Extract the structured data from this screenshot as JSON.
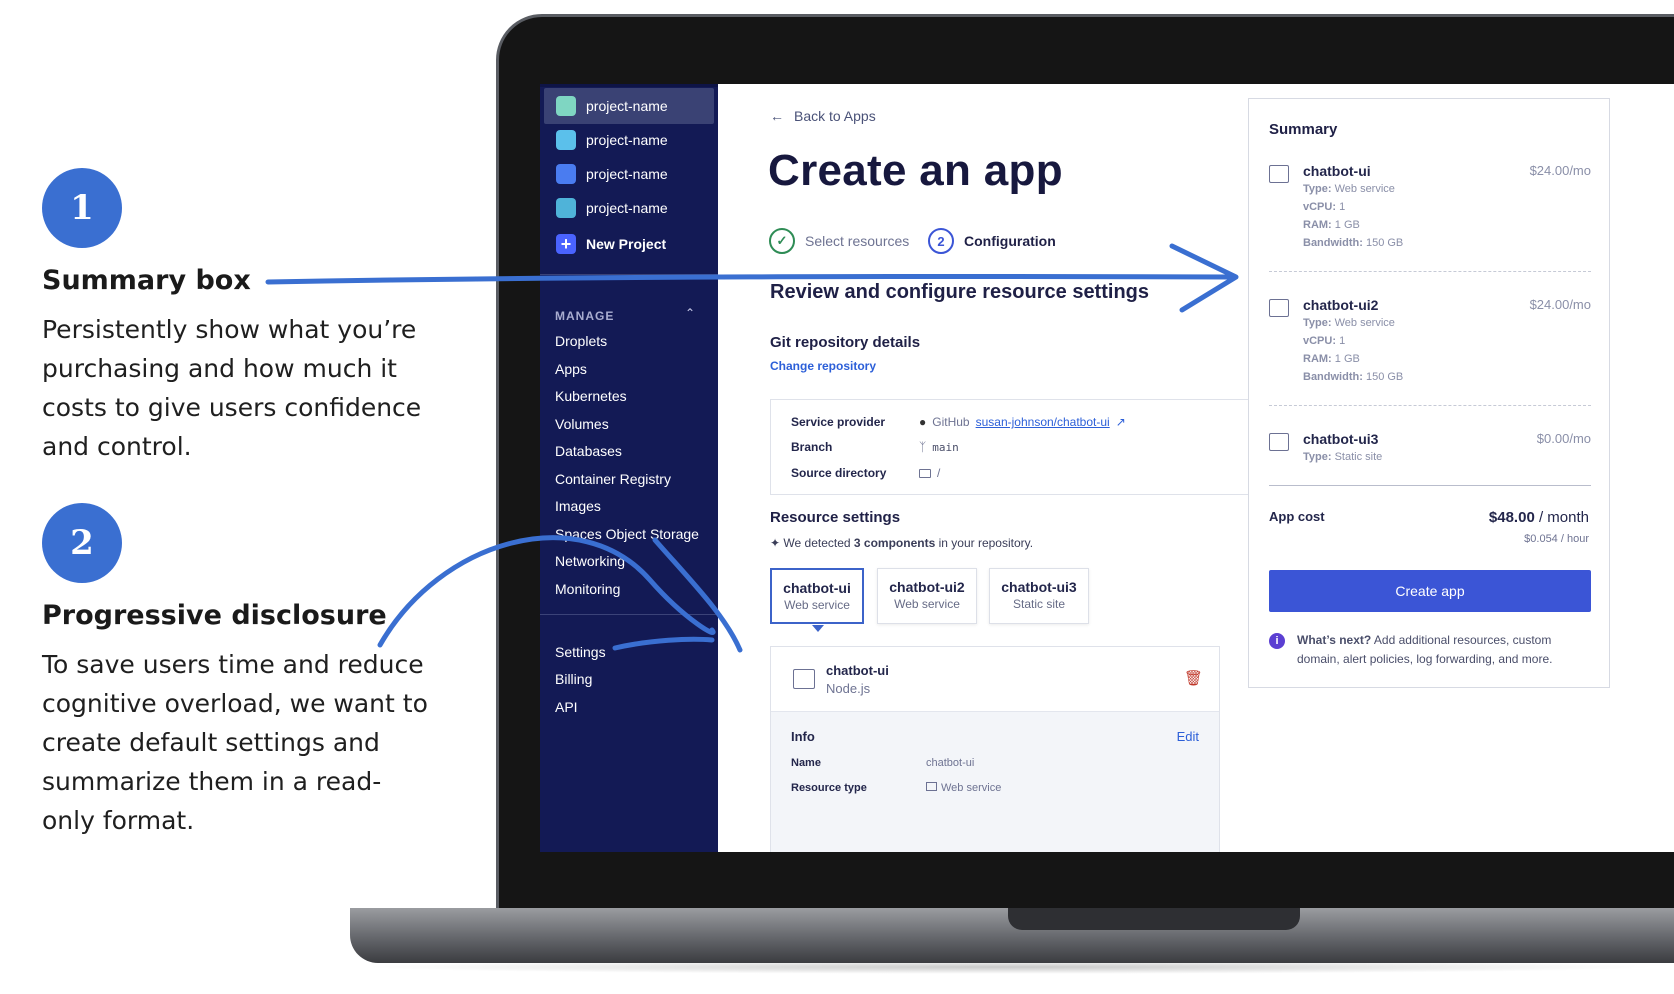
{
  "annotations": [
    {
      "number": "1",
      "title": "Summary box",
      "body": "Persistently show what you’re purchasing and how much it costs to give users confidence and control."
    },
    {
      "number": "2",
      "title": "Progressive disclosure",
      "body": "To save users time and reduce cognitive overload, we want to create default settings and summarize them in a read-only format."
    }
  ],
  "sidebar": {
    "projects": [
      {
        "label": "project-name",
        "color": "#7fd6c2"
      },
      {
        "label": "project-name",
        "color": "#5bc0eb"
      },
      {
        "label": "project-name",
        "color": "#4a7cf0"
      },
      {
        "label": "project-name",
        "color": "#4fb3d9"
      }
    ],
    "new_project": "New Project",
    "manage_heading": "MANAGE",
    "manage_items": [
      "Droplets",
      "Apps",
      "Kubernetes",
      "Volumes",
      "Databases",
      "Container Registry",
      "Images",
      "Spaces Object Storage",
      "Networking",
      "Monitoring"
    ],
    "bottom_items": [
      "Settings",
      "Billing",
      "API"
    ]
  },
  "main": {
    "back_link": "Back to Apps",
    "title": "Create an app",
    "steps": [
      {
        "label": "Select resources",
        "state": "done"
      },
      {
        "number": "2",
        "label": "Configuration",
        "state": "active"
      }
    ],
    "section_title": "Review and configure resource settings",
    "git": {
      "heading": "Git repository details",
      "change_link": "Change repository",
      "provider_label": "Service provider",
      "provider_value": "GitHub",
      "repo_link": "susan-johnson/chatbot-ui",
      "branch_label": "Branch",
      "branch_value": "main",
      "source_label": "Source directory",
      "source_value": "/"
    },
    "resources": {
      "heading": "Resource settings",
      "detect_prefix": "We detected",
      "detect_bold": "3 components",
      "detect_suffix": "in your repository.",
      "tabs": [
        {
          "name": "chatbot-ui",
          "type": "Web service"
        },
        {
          "name": "chatbot-ui2",
          "type": "Web service"
        },
        {
          "name": "chatbot-ui3",
          "type": "Static site"
        }
      ]
    },
    "component": {
      "name": "chatbot-ui",
      "runtime": "Node.js",
      "info_heading": "Info",
      "edit_label": "Edit",
      "name_label": "Name",
      "name_value": "chatbot-ui",
      "type_label": "Resource type",
      "type_value": "Web service"
    }
  },
  "summary": {
    "title": "Summary",
    "items": [
      {
        "name": "chatbot-ui",
        "price": "$24.00/mo",
        "lines": [
          [
            "Type:",
            "Web service"
          ],
          [
            "vCPU:",
            "1"
          ],
          [
            "RAM:",
            "1 GB"
          ],
          [
            "Bandwidth:",
            "150 GB"
          ]
        ]
      },
      {
        "name": "chatbot-ui2",
        "price": "$24.00/mo",
        "lines": [
          [
            "Type:",
            "Web service"
          ],
          [
            "vCPU:",
            "1"
          ],
          [
            "RAM:",
            "1 GB"
          ],
          [
            "Bandwidth:",
            "150 GB"
          ]
        ]
      },
      {
        "name": "chatbot-ui3",
        "price": "$0.00/mo",
        "lines": [
          [
            "Type:",
            "Static site"
          ]
        ]
      }
    ],
    "app_cost_label": "App cost",
    "app_cost_value": "$48.00",
    "app_cost_unit": "/ month",
    "hourly": "$0.054 / hour",
    "create_button": "Create app",
    "whats_next_bold": "What’s next?",
    "whats_next_text": "Add additional resources, custom domain, alert policies, log forwarding, and more."
  },
  "colors": {
    "accent": "#3a6fd1",
    "sidebar": "#131a55",
    "button": "#3b55d6"
  }
}
